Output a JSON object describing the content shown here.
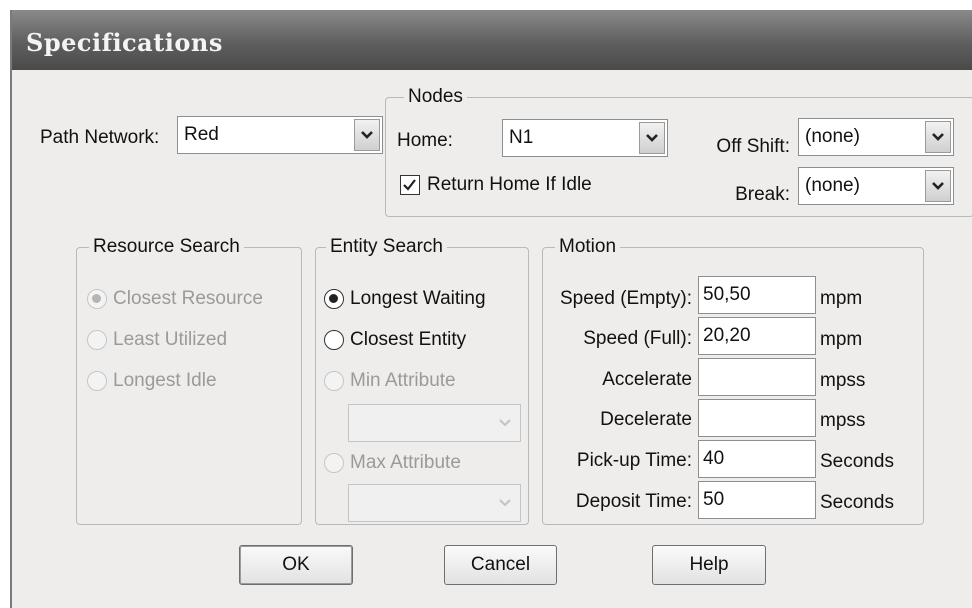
{
  "window": {
    "title": "Specifications"
  },
  "path_network": {
    "label": "Path Network:",
    "value": "Red"
  },
  "nodes": {
    "legend": "Nodes",
    "home_label": "Home:",
    "home_value": "N1",
    "return_home_label": "Return Home If Idle",
    "return_home_checked": true,
    "off_shift_label": "Off Shift:",
    "off_shift_value": "(none)",
    "break_label": "Break:",
    "break_value": "(none)"
  },
  "resource_search": {
    "legend": "Resource Search",
    "options": [
      "Closest Resource",
      "Least Utilized",
      "Longest Idle"
    ],
    "selected": "Closest Resource"
  },
  "entity_search": {
    "legend": "Entity Search",
    "longest_waiting": "Longest Waiting",
    "closest_entity": "Closest Entity",
    "min_attribute": "Min Attribute",
    "max_attribute": "Max Attribute",
    "selected": "Longest Waiting"
  },
  "motion": {
    "legend": "Motion",
    "speed_empty": {
      "label": "Speed (Empty):",
      "value": "50,50",
      "unit": "mpm"
    },
    "speed_full": {
      "label": "Speed (Full):",
      "value": "20,20",
      "unit": "mpm"
    },
    "accelerate": {
      "label": "Accelerate",
      "value": "",
      "unit": "mpss"
    },
    "decelerate": {
      "label": "Decelerate",
      "value": "",
      "unit": "mpss"
    },
    "pickup_time": {
      "label": "Pick-up Time:",
      "value": "40",
      "unit": "Seconds"
    },
    "deposit_time": {
      "label": "Deposit Time:",
      "value": "50",
      "unit": "Seconds"
    }
  },
  "buttons": {
    "ok": "OK",
    "cancel": "Cancel",
    "help": "Help"
  },
  "icons": {
    "dropdown": "chevron-down-icon",
    "check": "checkmark-icon",
    "radio": "radio-dot-icon"
  }
}
